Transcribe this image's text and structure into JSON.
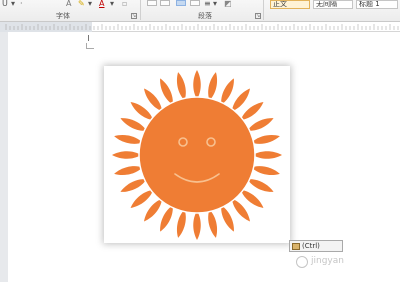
{
  "ribbon": {
    "font_group": {
      "label": "字体",
      "underline_icon": "underline-icon",
      "highlight_icon": "highlight-icon",
      "font_color_icon": "font-color-icon",
      "font_color": "#c00000"
    },
    "paragraph_group": {
      "label": "段落"
    },
    "styles_group": {
      "styles": [
        "正文",
        "无间隔",
        "标题 1"
      ]
    }
  },
  "document": {
    "picture": {
      "subject": "cartoon sun with smiley face",
      "colors": {
        "sun": "#ef7d34",
        "outline": "#ffffff",
        "eyes": "#f8c08f"
      }
    }
  },
  "paste_options": {
    "label": "(Ctrl)",
    "icon": "clipboard-icon"
  },
  "watermark": {
    "text": "jingyan"
  }
}
